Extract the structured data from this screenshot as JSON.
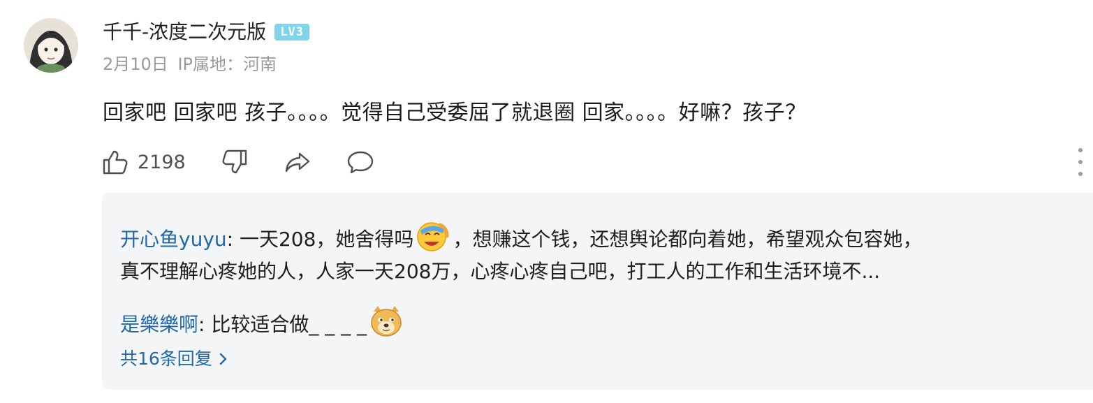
{
  "comment": {
    "username": "千千-浓度二次元版",
    "level_badge": "LV3",
    "date": "2月10日",
    "ip_location": "IP属地：河南",
    "text": "回家吧 回家吧  孩子。。。。觉得自己受委屈了就退圈 回家。。。。好嘛？孩子？",
    "like_count": "2198"
  },
  "replies": [
    {
      "author": "开心鱼yuyu",
      "separator": ": ",
      "text_before_emoji": "一天208，她舍得吗",
      "emoji": "laugh-cry-emoji",
      "text_after_emoji": "，想赚这个钱，还想舆论都向着她，希望观众包容她，",
      "text_line2": "真不理解心疼她的人，人家一天208万，心疼心疼自己吧，打工人的工作和生活环境不..."
    },
    {
      "author": "是樂樂啊",
      "separator": ": ",
      "text": "比较适合做_ _ _ _",
      "emoji": "doge-emoji"
    }
  ],
  "more_replies_label": "共16条回复",
  "colors": {
    "link_blue": "#2168a8",
    "level_badge": "#7fd4ec",
    "reply_bg": "#f4f5f7",
    "meta_gray": "#9a9a9a"
  },
  "icons": [
    "thumbs-up-icon",
    "thumbs-down-icon",
    "share-icon",
    "comment-icon",
    "more-vertical-icon",
    "chevron-right-icon"
  ]
}
